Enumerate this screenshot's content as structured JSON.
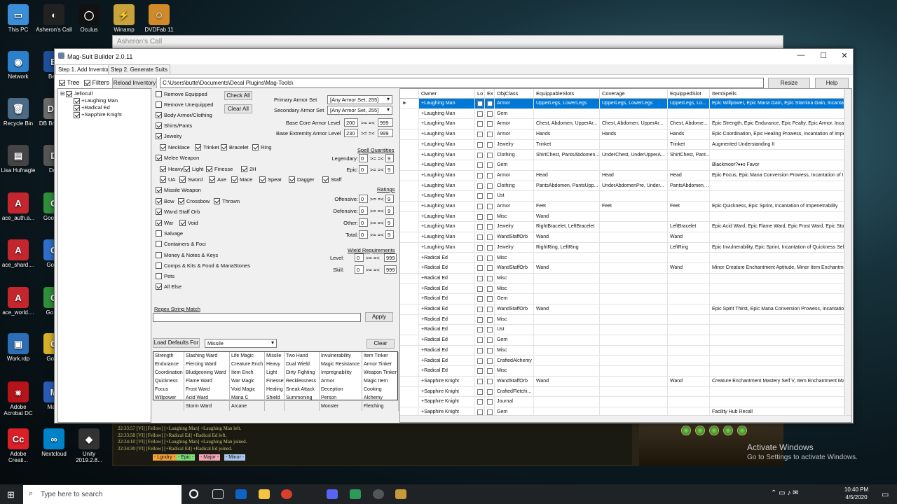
{
  "desktop": {
    "icons": [
      {
        "label": "This PC",
        "glyph": "▭",
        "color": "#3b8fd9"
      },
      {
        "label": "Asheron's Call",
        "glyph": "◐",
        "color": "#222"
      },
      {
        "label": "Oculus",
        "glyph": "◯",
        "color": "#111"
      },
      {
        "label": "Winamp",
        "glyph": "⚡",
        "color": "#c8a23a"
      },
      {
        "label": "DVDFab 11",
        "glyph": "☺",
        "color": "#d08a2a"
      },
      {
        "label": "Network",
        "glyph": "◉",
        "color": "#2c7fc9"
      },
      {
        "label": "Best",
        "glyph": "B",
        "color": "#1f4f9a"
      },
      {
        "label": "Recycle Bin",
        "glyph": "🗑",
        "color": "#4a6b85"
      },
      {
        "label": "DB Bro (SQ",
        "glyph": "DB",
        "color": "#6b6b6b"
      },
      {
        "label": "Lisa Hufnagle",
        "glyph": "▤",
        "color": "#444"
      },
      {
        "label": "Dec",
        "glyph": "D",
        "color": "#555"
      },
      {
        "label": "ace_auth.a...",
        "glyph": "A",
        "color": "#c4262e"
      },
      {
        "label": "Goo Chr",
        "glyph": "G",
        "color": "#2f8f3a"
      },
      {
        "label": "ace_shard....",
        "glyph": "A",
        "color": "#c4262e"
      },
      {
        "label": "Googl",
        "glyph": "G",
        "color": "#2f6fc9"
      },
      {
        "label": "ace_world....",
        "glyph": "A",
        "color": "#c4262e"
      },
      {
        "label": "Go Sh",
        "glyph": "G",
        "color": "#2f8f3a"
      },
      {
        "label": "Work.rdp",
        "glyph": "▣",
        "color": "#2c6fb7"
      },
      {
        "label": "Googl",
        "glyph": "G",
        "color": "#d8b12a"
      },
      {
        "label": "Adobe Acrobat DC",
        "glyph": "⨳",
        "color": "#b4141a"
      },
      {
        "label": "Malw",
        "glyph": "M",
        "color": "#2a5cb5"
      },
      {
        "label": "Adobe Creati...",
        "glyph": "Cc",
        "color": "#da1f26"
      },
      {
        "label": "Nextcloud",
        "glyph": "∞",
        "color": "#0082c9"
      },
      {
        "label": "Unity 2019.2.8...",
        "glyph": "◆",
        "color": "#333"
      }
    ]
  },
  "ac_window": {
    "title": "Asheron's Call"
  },
  "window": {
    "title": "Mag-Suit Builder 2.0.11",
    "tabs": [
      "Step 1. Add Inventory",
      "Step 2. Generate Suits"
    ],
    "toolbar": {
      "tree_label": "Tree",
      "tree_checked": true,
      "filters_label": "Filters",
      "filters_checked": true,
      "reload_label": "Reload Inventory",
      "path": "C:\\Users\\butte\\Documents\\Decal Plugins\\Mag-Tools\\",
      "resize_label": "Resize Columns",
      "help_label": "Help"
    },
    "tree": {
      "root": "Jellocull",
      "children": [
        "+Laughing Man",
        "+Radical Ed",
        "+Sapphire Knight"
      ]
    },
    "filters": {
      "checks": [
        {
          "label": "Remove Equipped",
          "on": false
        },
        {
          "label": "Remove Unequipped",
          "on": false
        },
        {
          "label": "Body Armor/Clothing",
          "on": true
        },
        {
          "label": "Shirts/Pants",
          "on": true
        },
        {
          "label": "Jewelry",
          "on": true
        }
      ],
      "jewelry_sub": [
        "Necklace",
        "Trinket",
        "Bracelet",
        "Ring"
      ],
      "melee_label": "Melee Weapon",
      "melee_sub1": [
        "Heavy",
        "Light",
        "Finesse",
        "2H"
      ],
      "melee_sub2": [
        "UA",
        "Sword",
        "Axe",
        "Mace",
        "Spear",
        "Dagger",
        "Staff"
      ],
      "missile_label": "Missile Weapon",
      "missile_sub": [
        "Bow",
        "Crossbow",
        "Thrown"
      ],
      "wand_label": "Wand Staff Orb",
      "wand_sub": [
        "War",
        "Void"
      ],
      "misc": [
        {
          "label": "Salvage",
          "on": false
        },
        {
          "label": "Containers & Foci",
          "on": false
        },
        {
          "label": "Money & Notes & Keys",
          "on": false
        },
        {
          "label": "Comps & Kits & Food & ManaStones",
          "on": false
        },
        {
          "label": "Pets",
          "on": false
        },
        {
          "label": "All Else",
          "on": true
        }
      ],
      "check_all": "Check All",
      "clear_all": "Clear All",
      "primary_set_label": "Primary Armor Set",
      "primary_set_value": "[Any Armor Set, 255]",
      "secondary_set_label": "Secondary Armor Set",
      "secondary_set_value": "[Any Armor Set, 255]",
      "base_core_label": "Base Core Armor Level",
      "base_core_min": "200",
      "base_core_max": "999",
      "base_ext_label": "Base Extremity Armor Level",
      "base_ext_min": "230",
      "base_ext_max": "999",
      "op_range": ">= =<",
      "spell_quantities": "Spell Quantities",
      "legendary_label": "Legendary:",
      "legendary_min": "0",
      "legendary_max": "9",
      "epic_label": "Epic:",
      "epic_min": "0",
      "epic_max": "9",
      "ratings": "Ratings",
      "offensive_label": "Offensive:",
      "offensive_min": "0",
      "offensive_max": "9",
      "defensive_label": "Defensive:",
      "defensive_min": "0",
      "defensive_max": "9",
      "other_label": "Other:",
      "other_min": "0",
      "other_max": "9",
      "total_label": "Total:",
      "total_min": "0",
      "total_max": "9",
      "wield_req": "Wield Requirements",
      "level_label": "Level:",
      "level_min": "0",
      "level_max": "999",
      "skill_label": "Skill:",
      "skill_min": "0",
      "skill_max": "999",
      "regex_label": "Regex String Match",
      "regex_value": "",
      "apply_label": "Apply",
      "load_defaults_label": "Load Defaults For",
      "defaults_value": "Missile",
      "clear_label": "Clear",
      "spell_grid": [
        [
          "Strength",
          "Slashing Ward",
          "Life Magic",
          "Missile",
          "Two Hand",
          "Invulnerability",
          "Item Tinker"
        ],
        [
          "Endurance",
          "Piercing Ward",
          "Creature Ench",
          "Heavy",
          "Dual Wield",
          "Magic Resistance",
          "Armor Tinker"
        ],
        [
          "Coordination",
          "Bludgeoning Ward",
          "Item Ench",
          "Light",
          "Dirty Fighting",
          "Impregnability",
          "Weapon Tinker"
        ],
        [
          "Quickness",
          "Flame Ward",
          "War Magic",
          "Finesse",
          "Recklessness",
          "Armor",
          "Magic Item"
        ],
        [
          "Focus",
          "Frost Ward",
          "Void Magic",
          "Healing",
          "Sneak Attack",
          "Deception",
          "Cooking"
        ],
        [
          "Willpower",
          "Acid Ward",
          "Mana C",
          "Shield",
          "Summoning",
          "Person",
          "Alchemy"
        ],
        [
          "",
          "Storm Ward",
          "Arcane",
          "",
          "",
          "Monster",
          "Fletching"
        ]
      ],
      "legend": [
        {
          "label": "- Lgndry -",
          "color": "#f6a23c"
        },
        {
          "label": "- Epic -",
          "color": "#7fe07a"
        },
        {
          "label": "- Major -",
          "color": "#f3a6b8"
        },
        {
          "label": "- Minor -",
          "color": "#a9c8ee"
        }
      ]
    },
    "grid": {
      "columns": [
        "Owner",
        "Lo",
        "Ex",
        "ObjClass",
        "EquippableSlots",
        "Coverage",
        "EquippedSlot",
        "ItemSpells"
      ],
      "rows": [
        [
          "+Laughing Man",
          "Armor",
          "UpperLegs, LowerLegs",
          "UpperLegs, LowerLegs",
          "UpperLegs, Lo...",
          "Epic Willpower, Epic Mana Gain, Epic Stamina Gain, Incantat"
        ],
        [
          "+Laughing Man",
          "Gem",
          "",
          "",
          "",
          ""
        ],
        [
          "+Laughing Man",
          "Armor",
          "Chest, Abdomen, UpperAr...",
          "Chest, Abdomen, UpperAr...",
          "Chest, Abdome...",
          "Epic Strength, Epic Endurance, Epic Fealty, Epic Armor, Inca"
        ],
        [
          "+Laughing Man",
          "Armor",
          "Hands",
          "Hands",
          "Hands",
          "Epic Coordination, Epic Healing Prowess, Incantation of Impe"
        ],
        [
          "+Laughing Man",
          "Jewelry",
          "Trinket",
          "",
          "Trinket",
          "Augmented Understanding II"
        ],
        [
          "+Laughing Man",
          "Clothing",
          "ShirtChest, PantsAbdomen...",
          "UnderChest, UnderUpperA...",
          "ShirtChest, Pant...",
          ""
        ],
        [
          "+Laughing Man",
          "Gem",
          "",
          "",
          "",
          "Blackmoor?♦♦s Favor"
        ],
        [
          "+Laughing Man",
          "Armor",
          "Head",
          "Head",
          "Head",
          "Epic Focus, Epic Mana Conversion Prowess, Incantation of I"
        ],
        [
          "+Laughing Man",
          "Clothing",
          "PantsAbdomen, PantsUpp...",
          "UnderAbdomenPre, Under...",
          "PantsAbdomen, ...",
          ""
        ],
        [
          "+Laughing Man",
          "Ust",
          "",
          "",
          "",
          ""
        ],
        [
          "+Laughing Man",
          "Armor",
          "Feet",
          "Feet",
          "Feet",
          "Epic Quickness, Epic Sprint, Incantation of Impenetrability"
        ],
        [
          "+Laughing Man",
          "Misc",
          "Wand",
          "",
          "",
          ""
        ],
        [
          "+Laughing Man",
          "Jewelry",
          "RightBracelet, LeftBracelet",
          "",
          "LeftBracelet",
          "Epic Acid Ward, Epic Flame Ward, Epic Frost Ward, Epic Sto"
        ],
        [
          "+Laughing Man",
          "WandStaffOrb",
          "Wand",
          "",
          "Wand",
          ""
        ],
        [
          "+Laughing Man",
          "Jewelry",
          "RightRing, LeftRing",
          "",
          "LeftRing",
          "Epic Invulnerability, Epic Sprint, Incantation of Quickness Sel"
        ],
        [
          "+Radical Ed",
          "Misc",
          "",
          "",
          "",
          ""
        ],
        [
          "+Radical Ed",
          "WandStaffOrb",
          "Wand",
          "",
          "Wand",
          "Minor Creature Enchantment Aptitude, Minor Item Enchantme"
        ],
        [
          "+Radical Ed",
          "Misc",
          "",
          "",
          "",
          ""
        ],
        [
          "+Radical Ed",
          "Misc",
          "",
          "",
          "",
          ""
        ],
        [
          "+Radical Ed",
          "Gem",
          "",
          "",
          "",
          ""
        ],
        [
          "+Radical Ed",
          "WandStaffOrb",
          "Wand",
          "",
          "",
          "Epic Spirit Thirst, Epic Mana Conversion Prowess, Incantatio"
        ],
        [
          "+Radical Ed",
          "Misc",
          "",
          "",
          "",
          ""
        ],
        [
          "+Radical Ed",
          "Ust",
          "",
          "",
          "",
          ""
        ],
        [
          "+Radical Ed",
          "Gem",
          "",
          "",
          "",
          ""
        ],
        [
          "+Radical Ed",
          "Misc",
          "",
          "",
          "",
          ""
        ],
        [
          "+Radical Ed",
          "CraftedAlchemy",
          "",
          "",
          "",
          ""
        ],
        [
          "+Radical Ed",
          "Misc",
          "",
          "",
          "",
          ""
        ],
        [
          "+Sapphire Knight",
          "WandStaffOrb",
          "Wand",
          "",
          "Wand",
          "Creature Enchantment Mastery Self V, Item Enchantment Ma"
        ],
        [
          "+Sapphire Knight",
          "CraftedFletchi...",
          "",
          "",
          "",
          ""
        ],
        [
          "+Sapphire Knight",
          "Journal",
          "",
          "",
          "",
          ""
        ],
        [
          "+Sapphire Knight",
          "Gem",
          "",
          "",
          "",
          "Facility Hub Recall"
        ]
      ]
    }
  },
  "chat": [
    "22:33:57 [VI] [Fellow] [+Laughing Man] +Laughing Man left.",
    "22:33:58 [VI] [Fellow] [+Radical Ed] +Radical Ed left.",
    "22:34:10 [VI] [Fellow] [+Laughing Man] +Laughing Man joined.",
    "22:34:30 [VI] [Fellow] [+Radical Ed] +Radical Ed joined."
  ],
  "activate": {
    "line1": "Activate Windows",
    "line2": "Go to Settings to activate Windows."
  },
  "taskbar": {
    "search_placeholder": "Type here to search",
    "time": "10:40 PM",
    "date": "4/5/2020"
  }
}
